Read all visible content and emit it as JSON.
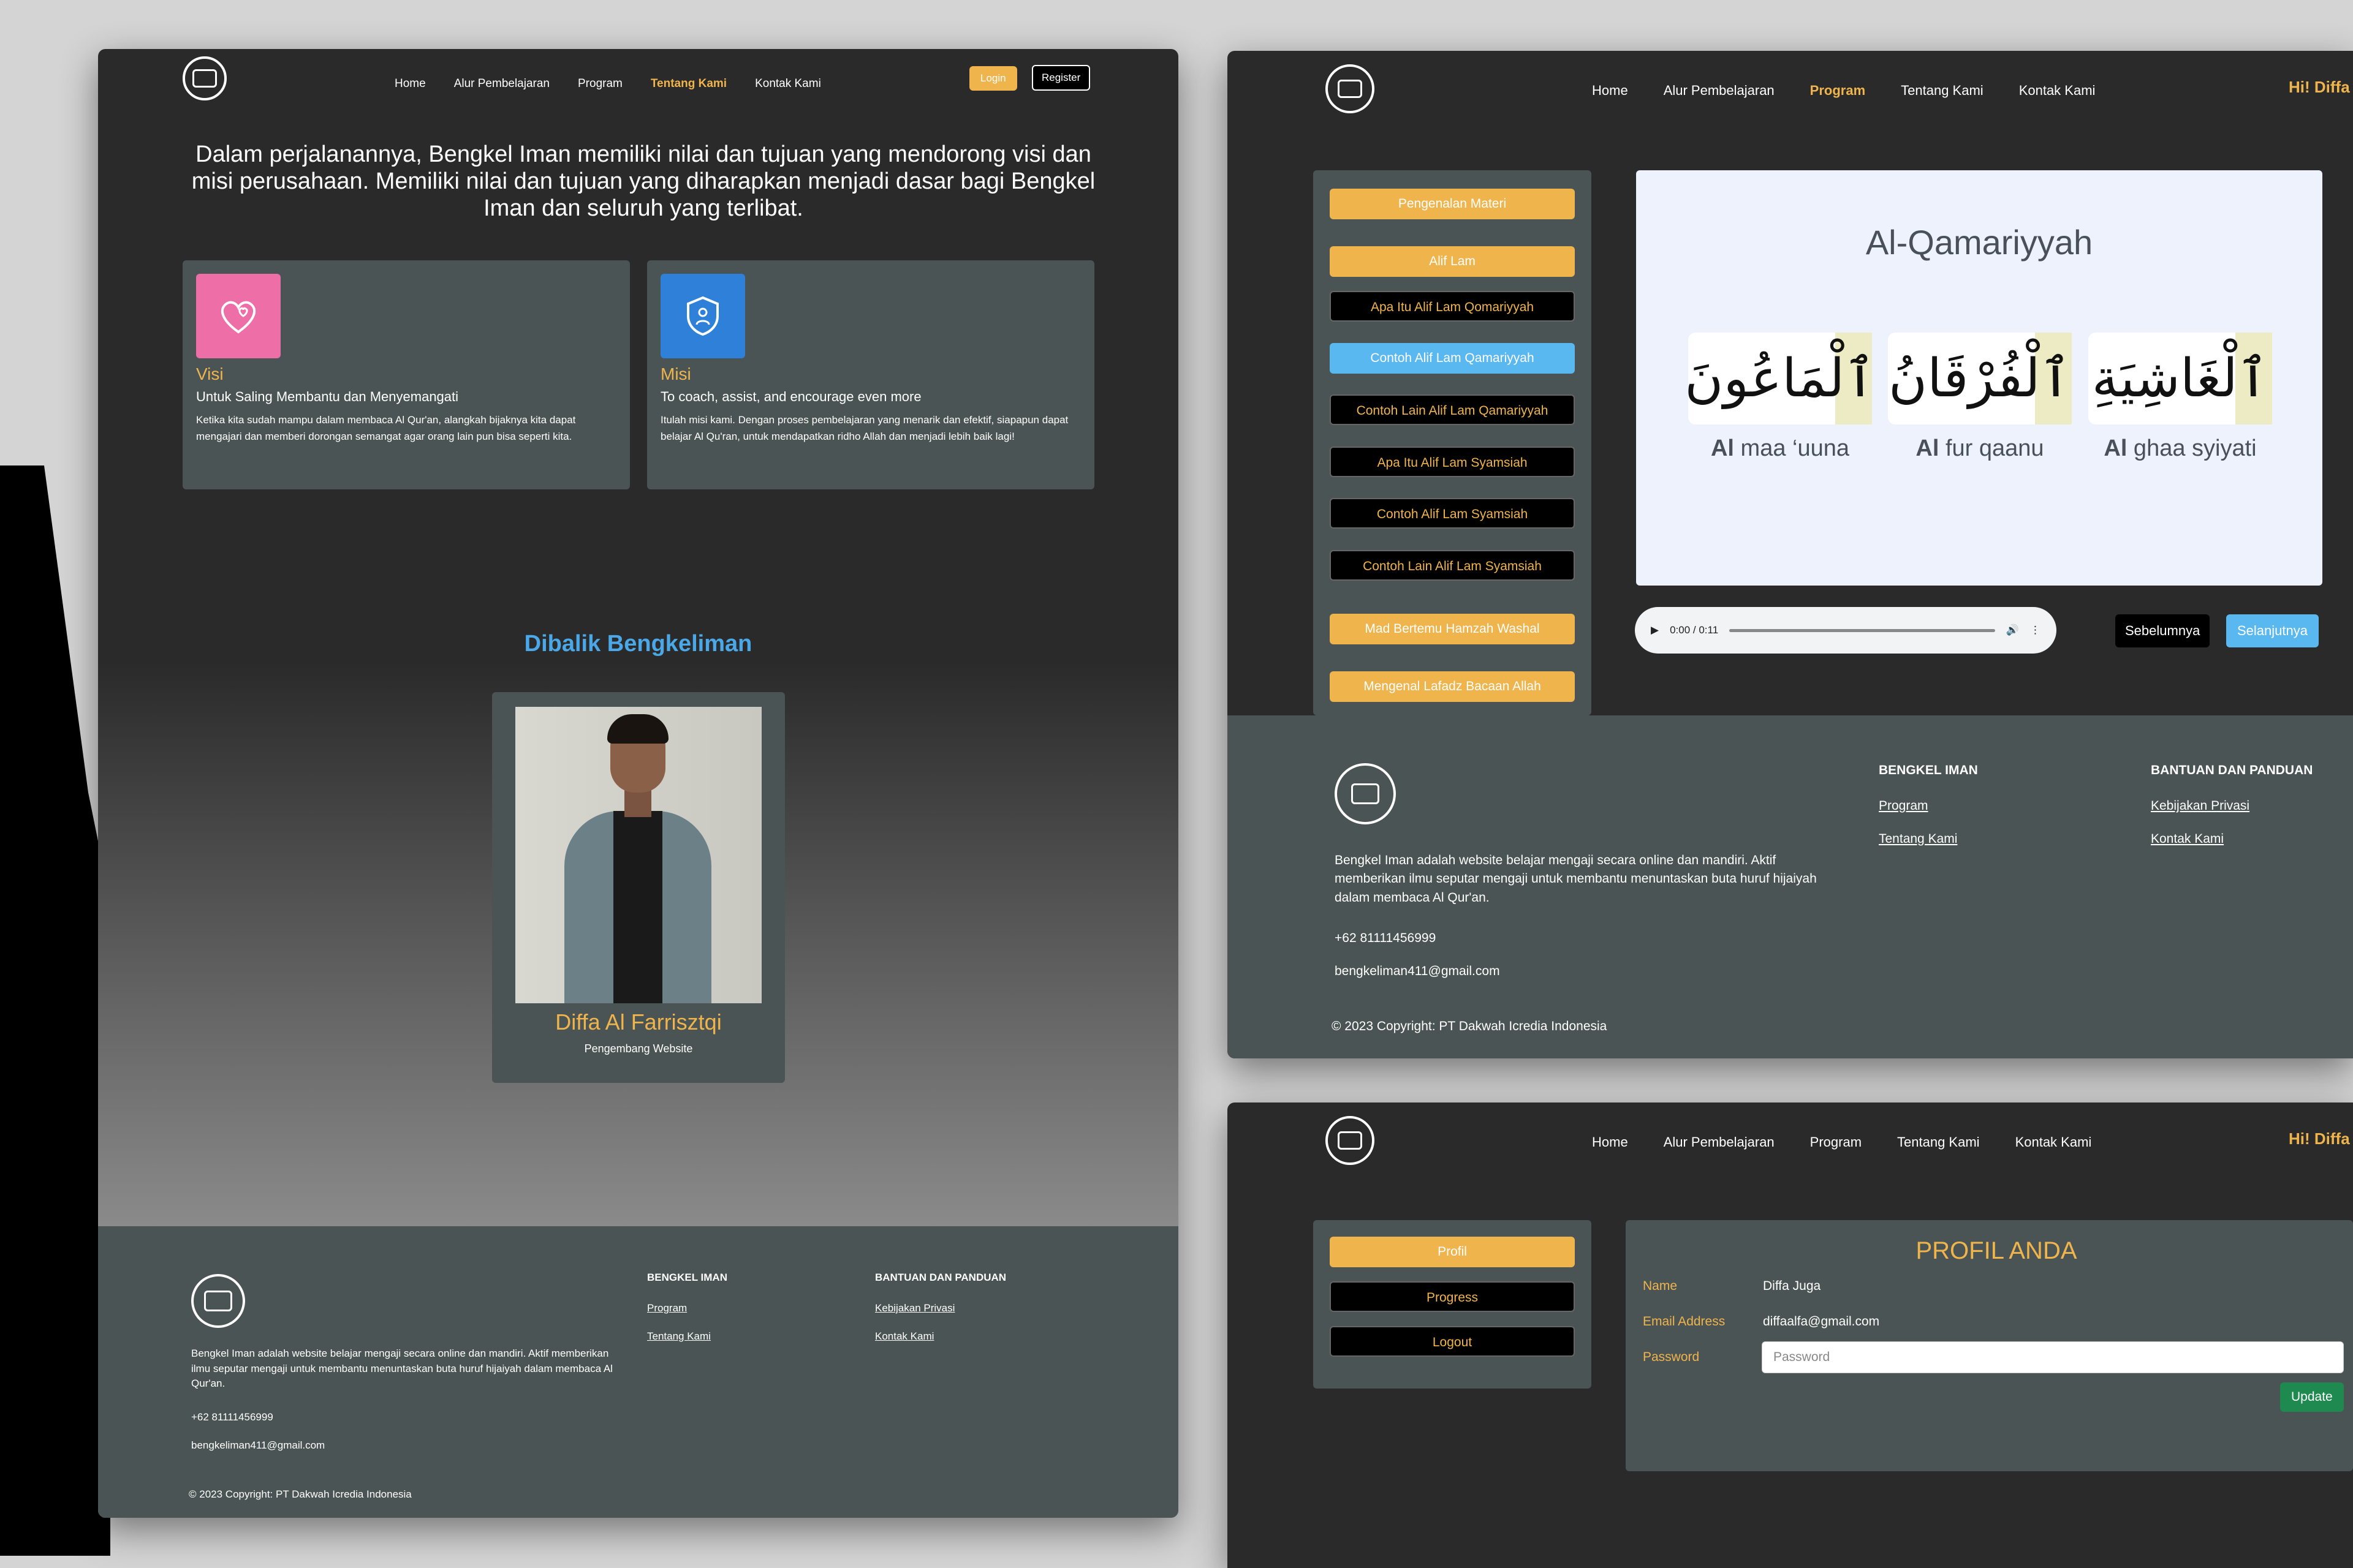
{
  "nav": {
    "home": "Home",
    "alur": "Alur Pembelajaran",
    "program": "Program",
    "tentang": "Tentang Kami",
    "kontak": "Kontak Kami",
    "login": "Login",
    "register": "Register",
    "greeting": "Hi! Diffa"
  },
  "about": {
    "intro": "Dalam perjalanannya, Bengkel Iman memiliki nilai dan tujuan yang mendorong visi dan misi perusahaan. Memiliki nilai dan tujuan yang diharapkan menjadi dasar bagi Bengkel Iman dan seluruh yang terlibat.",
    "visi": {
      "title": "Visi",
      "subtitle": "Untuk Saling Membantu dan Menyemangati",
      "desc": "Ketika kita sudah mampu dalam membaca Al Qur'an, alangkah bijaknya kita dapat mengajari dan memberi dorongan semangat agar orang lain pun bisa seperti kita.",
      "color": "#ee6fa7"
    },
    "misi": {
      "title": "Misi",
      "subtitle": "To coach, assist, and encourage even more",
      "desc": "Itulah misi kami. Dengan proses pembelajaran yang menarik dan efektif, siapapun dapat belajar Al Qu'ran, untuk mendapatkan ridho Allah dan menjadi lebih baik lagi!",
      "color": "#2f80d8"
    },
    "team_title": "Dibalik Bengkeliman",
    "person_name": "Diffa Al Farrisztqi",
    "person_role": "Pengembang Website"
  },
  "footer": {
    "desc": "Bengkel Iman adalah website belajar mengaji secara online dan mandiri. Aktif memberikan ilmu seputar mengaji untuk membantu menuntaskan buta huruf hijaiyah dalam membaca Al Qur'an.",
    "phone": "+62 81111456999",
    "email": "bengkeliman411@gmail.com",
    "col1_title": "BENGKEL IMAN",
    "col1_links": [
      "Program",
      "Tentang Kami"
    ],
    "col2_title": "BANTUAN DAN PANDUAN",
    "col2_links": [
      "Kebijakan Privasi",
      "Kontak Kami"
    ],
    "copyright": "© 2023 Copyright: PT Dakwah Icredia Indonesia"
  },
  "program": {
    "sidebar": [
      "Pengenalan Materi",
      "Alif Lam",
      "Apa Itu Alif Lam Qomariyyah",
      "Contoh Alif Lam Qamariyyah",
      "Contoh Lain Alif Lam Qamariyyah",
      "Apa Itu Alif Lam Syamsiah",
      "Contoh Alif Lam Syamsiah",
      "Contoh Lain Alif Lam Syamsiah",
      "Mad Bertemu Hamzah Washal",
      "Mengenal Lafadz Bacaan Allah"
    ],
    "lesson_title": "Al-Qamariyyah",
    "words": [
      {
        "arabic": "ٱلْمَاعُونَ",
        "bold": "Al",
        "rest": " maa ‘uuna"
      },
      {
        "arabic": "ٱلْفُرْقَانُ",
        "bold": "Al",
        "rest": " fur qaanu"
      },
      {
        "arabic": "ٱلْغَاشِيَةِ",
        "bold": "Al",
        "rest": " ghaa syiyati"
      }
    ],
    "audio_time": "0:00 / 0:11",
    "prev": "Sebelumnya",
    "next": "Selanjutnya"
  },
  "profile": {
    "menu": [
      "Profil",
      "Progress",
      "Logout"
    ],
    "title": "PROFIL ANDA",
    "name_label": "Name",
    "name_value": "Diffa Juga",
    "email_label": "Email Address",
    "email_value": "diffaalfa@gmail.com",
    "password_label": "Password",
    "password_placeholder": "Password",
    "update": "Update"
  }
}
